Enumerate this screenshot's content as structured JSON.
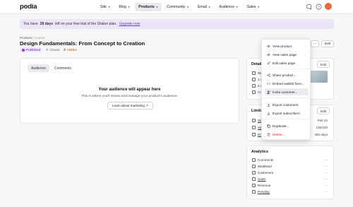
{
  "brand": {
    "logo": "podia"
  },
  "nav": [
    {
      "label": "Site",
      "active": false
    },
    {
      "label": "Blog",
      "active": false
    },
    {
      "label": "Products",
      "active": true
    },
    {
      "label": "Community",
      "active": false
    },
    {
      "label": "Email",
      "active": false
    },
    {
      "label": "Audience",
      "active": false
    },
    {
      "label": "Sales",
      "active": false
    }
  ],
  "banner": {
    "prefix": "You have",
    "days": "28 days",
    "suffix": "left on your free trial of the Shaker plan.",
    "link": "Upgrade now"
  },
  "breadcrumb": {
    "parent": "Products",
    "separator": "/",
    "current": "Course"
  },
  "product": {
    "title": "Design Fundamentals: From Concept to Creation",
    "status_published": "Published",
    "status_closed": "Closed",
    "status_hidden": "Hidden"
  },
  "header_buttons": {
    "more": "···",
    "edit": "Edit"
  },
  "audience_card": {
    "tabs": [
      "Audience",
      "Comments"
    ],
    "empty_title": "Your audience will appear here",
    "empty_sub": "This is where you'll review and manage your product's audience.",
    "learn_button": "Learn about marketing ↗"
  },
  "details_card": {
    "title": "Details",
    "edit": "Edit",
    "rows": [
      "Wa",
      "1 w",
      "2 c",
      "Cre"
    ]
  },
  "limits_card": {
    "title": "Limits",
    "edit": "Edit",
    "rows": [
      {
        "label": "Sta",
        "value": "Feb 24"
      },
      {
        "label": "Sig",
        "value": "100/100"
      },
      {
        "label": "Du",
        "value": "365 days"
      }
    ]
  },
  "analytics_card": {
    "title": "Analytics",
    "rows": [
      {
        "label": "Comments",
        "value": "—"
      },
      {
        "label": "Waitlisted",
        "value": "—"
      },
      {
        "label": "Customers",
        "value": "—"
      },
      {
        "label": "Sales",
        "value": "—"
      },
      {
        "label": "Revenue",
        "value": "—"
      },
      {
        "label": "Pending",
        "value": "—"
      }
    ]
  },
  "menu": {
    "items": [
      {
        "label": "View product",
        "icon": "eye-icon",
        "arrow": "›"
      },
      {
        "label": "View sales page",
        "icon": "eye-icon",
        "arrow": "›"
      },
      {
        "label": "Edit sales page",
        "icon": "pencil-icon"
      },
      {
        "label": "Share product...",
        "icon": "share-icon"
      },
      {
        "label": "Embed waitlist form...",
        "icon": "code-icon"
      },
      {
        "label": "Invite customer...",
        "icon": "user-plus-icon"
      },
      {
        "label": "Export customers",
        "icon": "download-icon"
      },
      {
        "label": "Export subscribers",
        "icon": "download-icon"
      },
      {
        "label": "Duplicate...",
        "icon": "copy-icon"
      },
      {
        "label": "Delete...",
        "icon": "trash-icon"
      }
    ]
  },
  "colors": {
    "accent": "#6b46c1",
    "danger": "#dc2626",
    "avatar": "#e8693d",
    "banner_bg": "#ece4f7"
  }
}
